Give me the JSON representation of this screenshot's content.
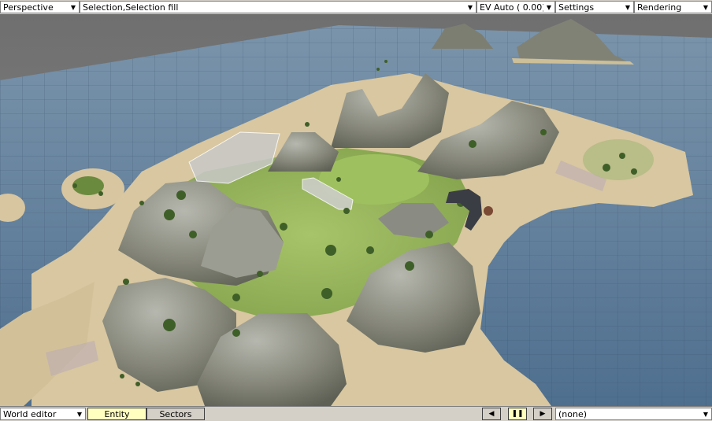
{
  "top_toolbar": {
    "view_mode": "Perspective",
    "selection_mode": "Selection,Selection fill",
    "exposure": "EV Auto ( 0.00)",
    "settings_label": "Settings",
    "rendering_label": "Rendering"
  },
  "bottom_toolbar": {
    "editor_mode": "World editor",
    "tabs": [
      {
        "label": "Entity",
        "active": true
      },
      {
        "label": "Sectors",
        "active": false
      }
    ],
    "playback": {
      "prev_glyph": "◀",
      "pause_glyph": "❚❚",
      "next_glyph": "▶"
    },
    "selection_value": "(none)"
  },
  "icons": {
    "dropdown_arrow": "▼"
  },
  "colors": {
    "toolbar_bg": "#d4d0c8",
    "active_tab": "#ffffc0",
    "water": "#5a7a98",
    "sand": "#d8c7a0",
    "grass": "#8fb054",
    "rock": "#8a8b82"
  }
}
